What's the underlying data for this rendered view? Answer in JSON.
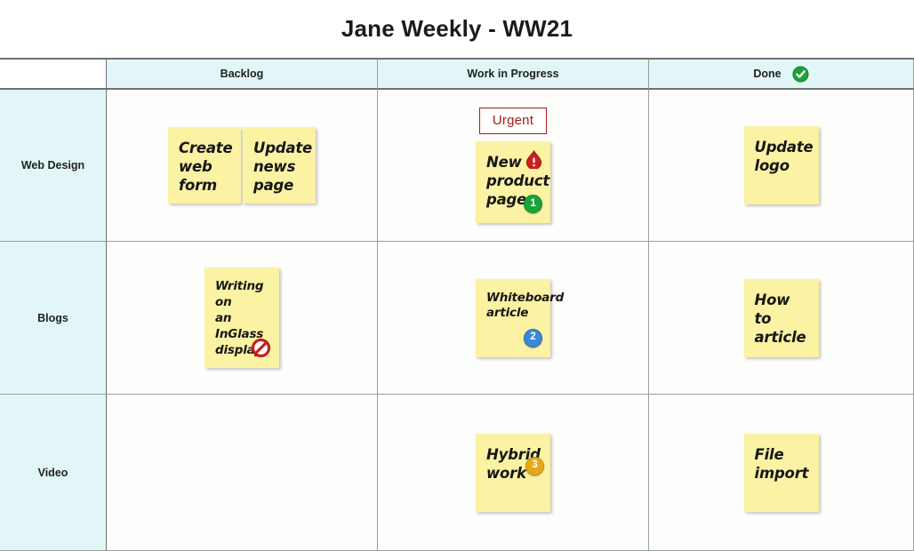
{
  "header": {
    "title": "Jane Weekly - WW21"
  },
  "columns": [
    {
      "label": "",
      "icon": ""
    },
    {
      "label": "Backlog",
      "icon": ""
    },
    {
      "label": "Work in Progress",
      "icon": ""
    },
    {
      "label": "Done",
      "icon": "check-circle-icon"
    }
  ],
  "rows": [
    {
      "label": "Web Design"
    },
    {
      "label": "Blogs"
    },
    {
      "label": "Video"
    }
  ],
  "colors": {
    "header_bg": "#e2f6f7",
    "note_yellow": "#fbf2a3",
    "urgent_red": "#9d1c17",
    "badge_green": "#1aa53a",
    "badge_blue": "#3b87d6",
    "badge_amber": "#e8a81c",
    "alert_red": "#cc1f1f"
  },
  "cells": {
    "webdesign_backlog": {
      "notes": [
        {
          "text": "Create\nweb form"
        },
        {
          "text": "Update\nnews\npage"
        }
      ]
    },
    "webdesign_wip": {
      "urgent_label": "Urgent",
      "notes": [
        {
          "text": "New\nproduct\npage",
          "badges": [
            {
              "name": "alert-icon",
              "type": "alert",
              "value": "!"
            },
            {
              "name": "priority-badge-1",
              "type": "num-green",
              "value": "1"
            }
          ]
        }
      ]
    },
    "webdesign_done": {
      "notes": [
        {
          "text": "Update\nlogo"
        }
      ]
    },
    "blogs_backlog": {
      "notes": [
        {
          "text": "Writing on\nan InGlass\ndisplay",
          "badges": [
            {
              "name": "blocked-icon",
              "type": "ban",
              "value": ""
            }
          ]
        }
      ]
    },
    "blogs_wip": {
      "notes": [
        {
          "text": "Whiteboard\narticle",
          "badges": [
            {
              "name": "priority-badge-2",
              "type": "num-blue",
              "value": "2"
            }
          ]
        }
      ]
    },
    "blogs_done": {
      "notes": [
        {
          "text": "How to\narticle"
        }
      ]
    },
    "video_backlog": {
      "notes": []
    },
    "video_wip": {
      "notes": [
        {
          "text": "Hybrid\nwork",
          "badges": [
            {
              "name": "priority-badge-3",
              "type": "num-amber",
              "value": "3"
            }
          ]
        }
      ]
    },
    "video_done": {
      "notes": [
        {
          "text": "File\nimport"
        }
      ]
    }
  }
}
